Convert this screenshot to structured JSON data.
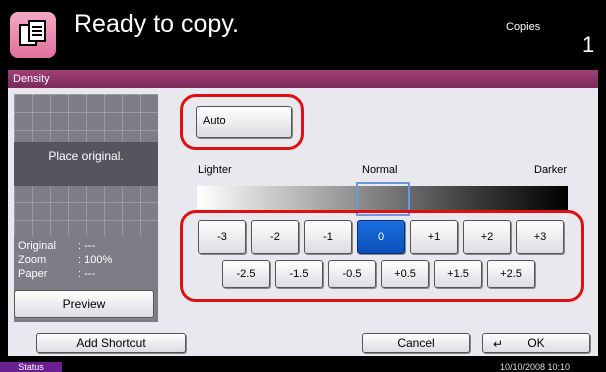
{
  "header": {
    "title": "Ready to copy.",
    "copies_label": "Copies",
    "copies_count": "1",
    "icon": "copy-icon"
  },
  "panel": {
    "title": "Density"
  },
  "preview": {
    "placeholder": "Place original.",
    "info": [
      {
        "label": "Original",
        "value": ": ---"
      },
      {
        "label": "Zoom",
        "value": ": 100%"
      },
      {
        "label": "Paper",
        "value": ": ---"
      }
    ],
    "button_label": "Preview"
  },
  "density": {
    "auto_label": "Auto",
    "lighter_label": "Lighter",
    "normal_label": "Normal",
    "darker_label": "Darker",
    "row1": [
      "-3",
      "-2",
      "-1",
      "0",
      "+1",
      "+2",
      "+3"
    ],
    "row2": [
      "-2.5",
      "-1.5",
      "-0.5",
      "+0.5",
      "+1.5",
      "+2.5"
    ],
    "selected": "0"
  },
  "footer": {
    "add_shortcut": "Add Shortcut",
    "cancel": "Cancel",
    "ok": "OK"
  },
  "status": {
    "label": "Status",
    "datetime": "10/10/2008   10:10"
  },
  "colors": {
    "accent": "#8a2f66",
    "selected": "#0a5fd0",
    "highlight_ring": "#e01010"
  }
}
